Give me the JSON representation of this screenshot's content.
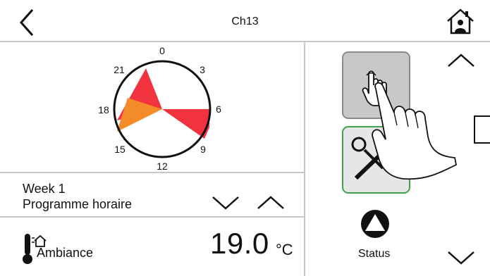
{
  "header": {
    "title": "Ch13",
    "back_icon": "chevron-left-icon",
    "home_icon": "home-person-icon"
  },
  "clock": {
    "labels": [
      "0",
      "3",
      "6",
      "9",
      "12",
      "15",
      "18",
      "21"
    ],
    "colors": {
      "red": "#f0333e",
      "orange": "#f38b29"
    }
  },
  "schedule": {
    "week": "Week 1",
    "program": "Programme horaire",
    "down_icon": "chevron-down-icon",
    "up_icon": "chevron-up-icon"
  },
  "temperature": {
    "label": "Ambiance",
    "value": "19.0",
    "unit": "°C"
  },
  "sidebar": {
    "status_label": "Status",
    "selected_border_color": "#3fa34d",
    "scroll_up_icon": "chevron-up-icon",
    "scroll_down_icon": "chevron-down-icon"
  }
}
